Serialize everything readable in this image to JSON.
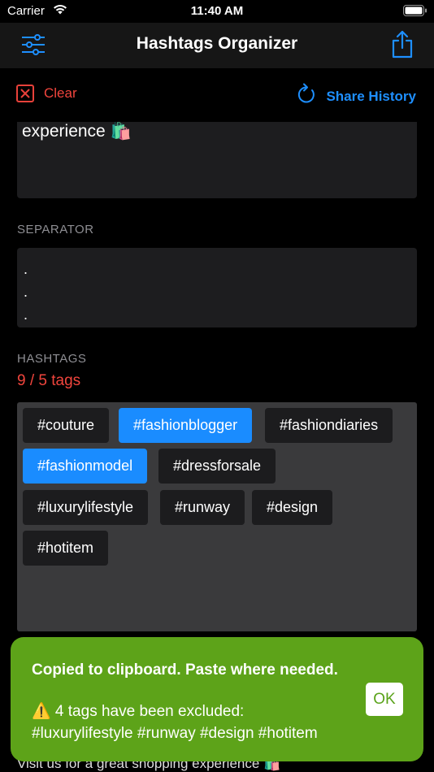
{
  "status": {
    "carrier": "Carrier",
    "time": "11:40 AM"
  },
  "nav": {
    "title": "Hashtags Organizer",
    "filter_icon": "sliders-icon",
    "share_icon": "share-icon"
  },
  "toolbar": {
    "clear_label": "Clear",
    "history_label": "Share History",
    "accent_red": "#f1453d",
    "accent_blue": "#1e8fff"
  },
  "text": {
    "visible_line": "experience 🛍️"
  },
  "separator": {
    "label": "SEPARATOR",
    "lines": [
      ".",
      ".",
      "."
    ]
  },
  "hashtags": {
    "label": "HASHTAGS",
    "count": "9 / 5 tags",
    "tags": [
      {
        "text": "#couture",
        "selected": false
      },
      {
        "text": "#fashionblogger",
        "selected": true
      },
      {
        "text": "#fashiondiaries",
        "selected": false
      },
      {
        "text": "#fashionmodel",
        "selected": true
      },
      {
        "text": "#dressforsale",
        "selected": false
      },
      {
        "text": "#luxurylifestyle",
        "selected": false
      },
      {
        "text": "#runway",
        "selected": false
      },
      {
        "text": "#design",
        "selected": false
      },
      {
        "text": "#hotitem",
        "selected": false
      }
    ]
  },
  "footer": {
    "text": "Visit us for a great shopping experience 🛍️"
  },
  "toast": {
    "message": "Copied to clipboard. Paste where needed.",
    "warning_line1": "⚠️ 4 tags have been excluded:",
    "warning_line2": "#luxurylifestyle #runway #design #hotitem",
    "ok_label": "OK",
    "color": "#5da319"
  }
}
